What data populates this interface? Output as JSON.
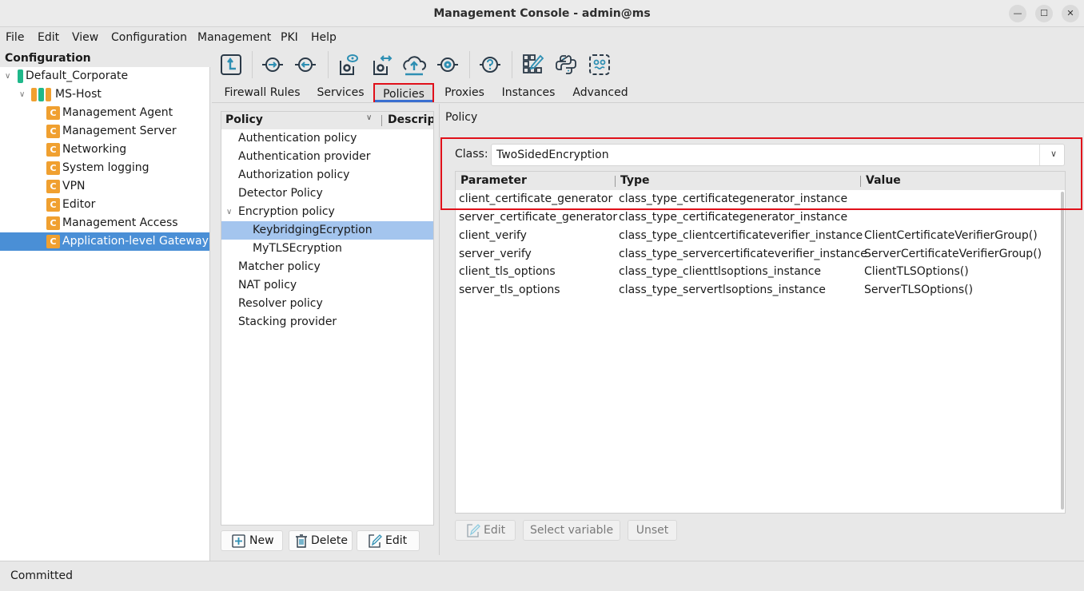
{
  "window": {
    "title": "Management Console - admin@ms",
    "controls": {
      "minimize": "—",
      "maximize": "☐",
      "close": "✕"
    }
  },
  "menu": [
    "File",
    "Edit",
    "View",
    "Configuration",
    "Management",
    "PKI",
    "Help"
  ],
  "tree": {
    "header": "Configuration",
    "root": "Default_Corporate",
    "host": "MS-Host",
    "component_icon_letter": "C",
    "components": [
      "Management Agent",
      "Management Server",
      "Networking",
      "System logging",
      "VPN",
      "Editor",
      "Management Access",
      "Application-level Gateway"
    ],
    "selected": "Application-level Gateway"
  },
  "toolbar": {
    "icons": [
      "upload-config-icon",
      "connect-in-icon",
      "connect-out-icon",
      "view-config-icon",
      "compare-config-icon",
      "cloud-upload-icon",
      "service-icon",
      "help-icon",
      "edit-grid-icon",
      "python-icon",
      "robot-icon"
    ]
  },
  "tabs": [
    "Firewall Rules",
    "Services",
    "Policies",
    "Proxies",
    "Instances",
    "Advanced"
  ],
  "active_tab": "Policies",
  "policy_list": {
    "columns": [
      "Policy",
      "Descript"
    ],
    "items": [
      {
        "label": "Authentication policy",
        "level": 0
      },
      {
        "label": "Authentication provider",
        "level": 0
      },
      {
        "label": "Authorization policy",
        "level": 0
      },
      {
        "label": "Detector Policy",
        "level": 0
      },
      {
        "label": "Encryption policy",
        "level": 0,
        "expanded": true
      },
      {
        "label": "KeybridgingEcryption",
        "level": 1,
        "selected": true
      },
      {
        "label": "MyTLSEcryption",
        "level": 1
      },
      {
        "label": "Matcher policy",
        "level": 0
      },
      {
        "label": "NAT policy",
        "level": 0
      },
      {
        "label": "Resolver policy",
        "level": 0
      },
      {
        "label": "Stacking provider",
        "level": 0
      }
    ],
    "buttons": {
      "new": "New",
      "delete": "Delete",
      "edit": "Edit"
    }
  },
  "policy_detail": {
    "section_title": "Policy",
    "class_label": "Class:",
    "class_value": "TwoSidedEncryption",
    "columns": [
      "Parameter",
      "Type",
      "Value"
    ],
    "rows": [
      {
        "parameter": "client_certificate_generator",
        "type": "class_type_certificategenerator_instance",
        "value": ""
      },
      {
        "parameter": "server_certificate_generator",
        "type": "class_type_certificategenerator_instance",
        "value": ""
      },
      {
        "parameter": "client_verify",
        "type": "class_type_clientcertificateverifier_instance",
        "value": "ClientCertificateVerifierGroup()"
      },
      {
        "parameter": "server_verify",
        "type": "class_type_servercertificateverifier_instance",
        "value": "ServerCertificateVerifierGroup()"
      },
      {
        "parameter": "client_tls_options",
        "type": "class_type_clienttlsoptions_instance",
        "value": "ClientTLSOptions()"
      },
      {
        "parameter": "server_tls_options",
        "type": "class_type_servertlsoptions_instance",
        "value": "ServerTLSOptions()"
      }
    ],
    "buttons": {
      "edit": "Edit",
      "select_variable": "Select variable",
      "unset": "Unset"
    }
  },
  "status": "Committed",
  "colors": {
    "highlight": "#e0101a",
    "selection": "#4a8fd6",
    "list_selection": "#a4c5ee",
    "component_icon": "#f0a030",
    "root_icon": "#1fb88a",
    "toolbar_icon": "#2e8fb3"
  }
}
